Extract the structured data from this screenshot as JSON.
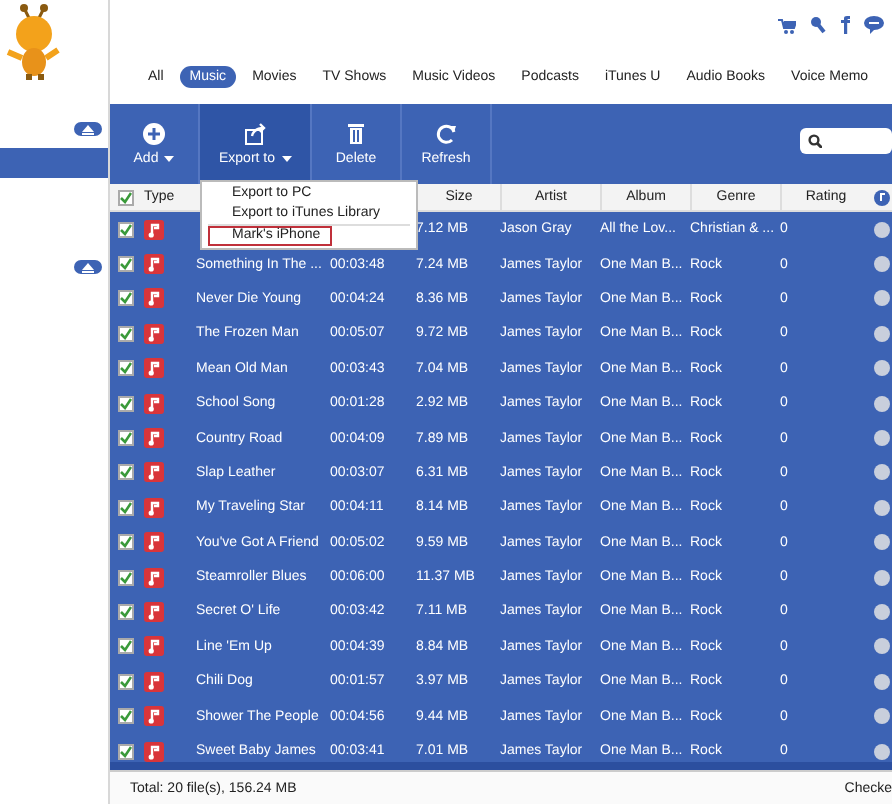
{
  "sidebar": {
    "items": [
      {
        "selected": true
      }
    ]
  },
  "tabs": [
    {
      "label": "All",
      "selected": false
    },
    {
      "label": "Music",
      "selected": true
    },
    {
      "label": "Movies",
      "selected": false
    },
    {
      "label": "TV Shows",
      "selected": false
    },
    {
      "label": "Music Videos",
      "selected": false
    },
    {
      "label": "Podcasts",
      "selected": false
    },
    {
      "label": "iTunes U",
      "selected": false
    },
    {
      "label": "Audio Books",
      "selected": false
    },
    {
      "label": "Voice Memo",
      "selected": false
    }
  ],
  "toolbar": [
    {
      "kind": "add",
      "label": "Add",
      "dropdown": true,
      "selected": false
    },
    {
      "kind": "export",
      "label": "Export to",
      "dropdown": true,
      "selected": true
    },
    {
      "kind": "delete",
      "label": "Delete",
      "dropdown": false,
      "selected": false
    },
    {
      "kind": "refresh",
      "label": "Refresh",
      "dropdown": false,
      "selected": false
    }
  ],
  "export_menu": [
    {
      "label": "Export to PC",
      "selected": false
    },
    {
      "label": "Export to iTunes Library",
      "selected": false
    },
    {
      "label": "Mark's iPhone",
      "selected": true
    }
  ],
  "table": {
    "all_checked": true,
    "columns": [
      "Type",
      "Size",
      "Artist",
      "Album",
      "Genre",
      "Rating"
    ],
    "rows": [
      {
        "checked": true,
        "size": "7.12 MB",
        "artist": "Jason Gray",
        "album": "All the Lov...",
        "genre": "Christian & ...",
        "rating": "0"
      },
      {
        "checked": true,
        "name": "Something In The ...",
        "time": "00:03:48",
        "size": "7.24 MB",
        "artist": "James Taylor",
        "album": "One Man B...",
        "genre": "Rock",
        "rating": "0"
      },
      {
        "checked": true,
        "name": "Never Die Young",
        "time": "00:04:24",
        "size": "8.36 MB",
        "artist": "James Taylor",
        "album": "One Man B...",
        "genre": "Rock",
        "rating": "0"
      },
      {
        "checked": true,
        "name": "The Frozen Man",
        "time": "00:05:07",
        "size": "9.72 MB",
        "artist": "James Taylor",
        "album": "One Man B...",
        "genre": "Rock",
        "rating": "0"
      },
      {
        "checked": true,
        "name": "Mean Old Man",
        "time": "00:03:43",
        "size": "7.04 MB",
        "artist": "James Taylor",
        "album": "One Man B...",
        "genre": "Rock",
        "rating": "0"
      },
      {
        "checked": true,
        "name": "School Song",
        "time": "00:01:28",
        "size": "2.92 MB",
        "artist": "James Taylor",
        "album": "One Man B...",
        "genre": "Rock",
        "rating": "0"
      },
      {
        "checked": true,
        "name": "Country Road",
        "time": "00:04:09",
        "size": "7.89 MB",
        "artist": "James Taylor",
        "album": "One Man B...",
        "genre": "Rock",
        "rating": "0"
      },
      {
        "checked": true,
        "name": "Slap Leather",
        "time": "00:03:07",
        "size": "6.31 MB",
        "artist": "James Taylor",
        "album": "One Man B...",
        "genre": "Rock",
        "rating": "0"
      },
      {
        "checked": true,
        "name": "My Traveling Star",
        "time": "00:04:11",
        "size": "8.14 MB",
        "artist": "James Taylor",
        "album": "One Man B...",
        "genre": "Rock",
        "rating": "0"
      },
      {
        "checked": true,
        "name": "You've Got A Friend",
        "time": "00:05:02",
        "size": "9.59 MB",
        "artist": "James Taylor",
        "album": "One Man B...",
        "genre": "Rock",
        "rating": "0"
      },
      {
        "checked": true,
        "name": "Steamroller Blues",
        "time": "00:06:00",
        "size": "11.37 MB",
        "artist": "James Taylor",
        "album": "One Man B...",
        "genre": "Rock",
        "rating": "0"
      },
      {
        "checked": true,
        "name": "Secret O' Life",
        "time": "00:03:42",
        "size": "7.11 MB",
        "artist": "James Taylor",
        "album": "One Man B...",
        "genre": "Rock",
        "rating": "0"
      },
      {
        "checked": true,
        "name": "Line 'Em Up",
        "time": "00:04:39",
        "size": "8.84 MB",
        "artist": "James Taylor",
        "album": "One Man B...",
        "genre": "Rock",
        "rating": "0"
      },
      {
        "checked": true,
        "name": "Chili Dog",
        "time": "00:01:57",
        "size": "3.97 MB",
        "artist": "James Taylor",
        "album": "One Man B...",
        "genre": "Rock",
        "rating": "0"
      },
      {
        "checked": true,
        "name": "Shower The People",
        "time": "00:04:56",
        "size": "9.44 MB",
        "artist": "James Taylor",
        "album": "One Man B...",
        "genre": "Rock",
        "rating": "0"
      },
      {
        "checked": true,
        "name": "Sweet Baby James",
        "time": "00:03:41",
        "size": "7.01 MB",
        "artist": "James Taylor",
        "album": "One Man B...",
        "genre": "Rock",
        "rating": "0"
      }
    ]
  },
  "status_bar": {
    "total": "Total: 20 file(s), 156.24 MB",
    "right": "Checke"
  }
}
